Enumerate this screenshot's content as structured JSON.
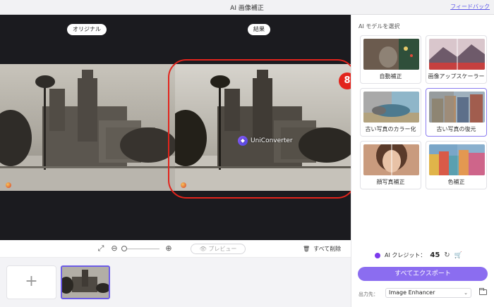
{
  "window": {
    "title": "AI 画像補正",
    "feedback_link": "フィードバック"
  },
  "stage": {
    "original_label": "オリジナル",
    "result_label": "結果",
    "watermark_text": "UniConverter",
    "callout_number": "8"
  },
  "toolbar": {
    "icons": [
      "fit-screen-icon",
      "zoom-out-icon",
      "zoom-in-icon",
      "trash-icon"
    ],
    "zoom_level": 0,
    "preview_label": "プレビュー",
    "delete_all_label": "すべて削除"
  },
  "filmstrip": {
    "add_symbol": "+"
  },
  "side": {
    "header": "AI モデルを選択",
    "models": [
      {
        "label": "自動補正",
        "selected": false
      },
      {
        "label": "画像アップスケーラー",
        "selected": false
      },
      {
        "label": "古い写真のカラー化",
        "selected": false
      },
      {
        "label": "古い写真の復元",
        "selected": true
      },
      {
        "label": "顔写真補正",
        "selected": false
      },
      {
        "label": "色補正",
        "selected": false
      }
    ],
    "credit_label": "AI クレジット：",
    "credit_value": "45",
    "export_label": "すべてエクスポート",
    "output_label": "出力先：",
    "output_value": "Image Enhancer"
  },
  "colors": {
    "accent": "#8b6df0",
    "highlight": "#e2241c",
    "stage_bg": "#1b1b1f"
  }
}
